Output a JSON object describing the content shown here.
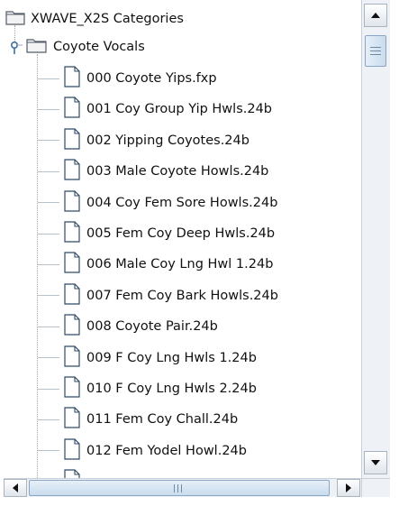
{
  "tree": {
    "root_label": "XWAVE_X2S Categories",
    "folder_label": "Coyote Vocals",
    "files": [
      "000 Coyote Yips.fxp",
      "001 Coy Group Yip Hwls.24b",
      "002 Yipping Coyotes.24b",
      "003 Male Coyote Howls.24b",
      "004 Coy Fem Sore Howls.24b",
      "005 Fem Coy Deep Hwls.24b",
      "006 Male Coy Lng Hwl 1.24b",
      "007 Fem Coy Bark Howls.24b",
      "008 Coyote Pair.24b",
      "009 F Coy Lng Hwls 1.24b",
      "010 F Coy Lng Hwls 2.24b",
      "011 Fem Coy Chall.24b",
      "012 Fem Yodel Howl.24b"
    ]
  },
  "scroll": {
    "vertical_position": 0.02,
    "horizontal_position": 0.0
  },
  "colors": {
    "folder_fill": "#f2f2f2",
    "folder_edge": "#555e6a",
    "file_edge": "#2f4a66",
    "tree_line": "#9aa6b0",
    "scroll_thumb": "#c9dced"
  },
  "icons": {
    "root": "folder-icon",
    "folder": "open-folder-icon",
    "file": "file-icon",
    "expand_handle": "expanded-node-handle-icon"
  }
}
